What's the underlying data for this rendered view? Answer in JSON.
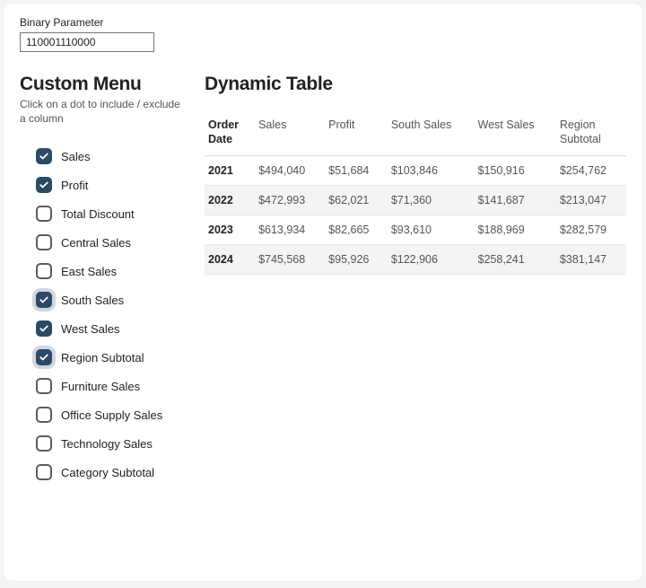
{
  "parameter": {
    "label": "Binary Parameter",
    "value": "110001110000"
  },
  "menu": {
    "title": "Custom Menu",
    "subtitle": "Click on a dot to include / exclude a column",
    "items": [
      {
        "label": "Sales",
        "checked": true,
        "selected": false
      },
      {
        "label": "Profit",
        "checked": true,
        "selected": false
      },
      {
        "label": "Total Discount",
        "checked": false,
        "selected": false
      },
      {
        "label": "Central Sales",
        "checked": false,
        "selected": false
      },
      {
        "label": "East Sales",
        "checked": false,
        "selected": false
      },
      {
        "label": "South Sales",
        "checked": true,
        "selected": true
      },
      {
        "label": "West Sales",
        "checked": true,
        "selected": false
      },
      {
        "label": "Region Subtotal",
        "checked": true,
        "selected": true
      },
      {
        "label": "Furniture Sales",
        "checked": false,
        "selected": false
      },
      {
        "label": "Office Supply Sales",
        "checked": false,
        "selected": false
      },
      {
        "label": "Technology Sales",
        "checked": false,
        "selected": false
      },
      {
        "label": "Category Subtotal",
        "checked": false,
        "selected": false
      }
    ]
  },
  "table": {
    "title": "Dynamic Table",
    "columns": [
      "Order Date",
      "Sales",
      "Profit",
      "South Sales",
      "West Sales",
      "Region Subtotal"
    ],
    "rows": [
      [
        "2021",
        "$494,040",
        "$51,684",
        "$103,846",
        "$150,916",
        "$254,762"
      ],
      [
        "2022",
        "$472,993",
        "$62,021",
        "$71,360",
        "$141,687",
        "$213,047"
      ],
      [
        "2023",
        "$613,934",
        "$82,665",
        "$93,610",
        "$188,969",
        "$282,579"
      ],
      [
        "2024",
        "$745,568",
        "$95,926",
        "$122,906",
        "$258,241",
        "$381,147"
      ]
    ]
  },
  "chart_data": {
    "type": "table",
    "title": "Dynamic Table",
    "columns": [
      "Order Date",
      "Sales",
      "Profit",
      "South Sales",
      "West Sales",
      "Region Subtotal"
    ],
    "rows": [
      {
        "Order Date": 2021,
        "Sales": 494040,
        "Profit": 51684,
        "South Sales": 103846,
        "West Sales": 150916,
        "Region Subtotal": 254762
      },
      {
        "Order Date": 2022,
        "Sales": 472993,
        "Profit": 62021,
        "South Sales": 71360,
        "West Sales": 141687,
        "Region Subtotal": 213047
      },
      {
        "Order Date": 2023,
        "Sales": 613934,
        "Profit": 82665,
        "South Sales": 93610,
        "West Sales": 188969,
        "Region Subtotal": 282579
      },
      {
        "Order Date": 2024,
        "Sales": 745568,
        "Profit": 95926,
        "South Sales": 122906,
        "West Sales": 258241,
        "Region Subtotal": 381147
      }
    ]
  }
}
